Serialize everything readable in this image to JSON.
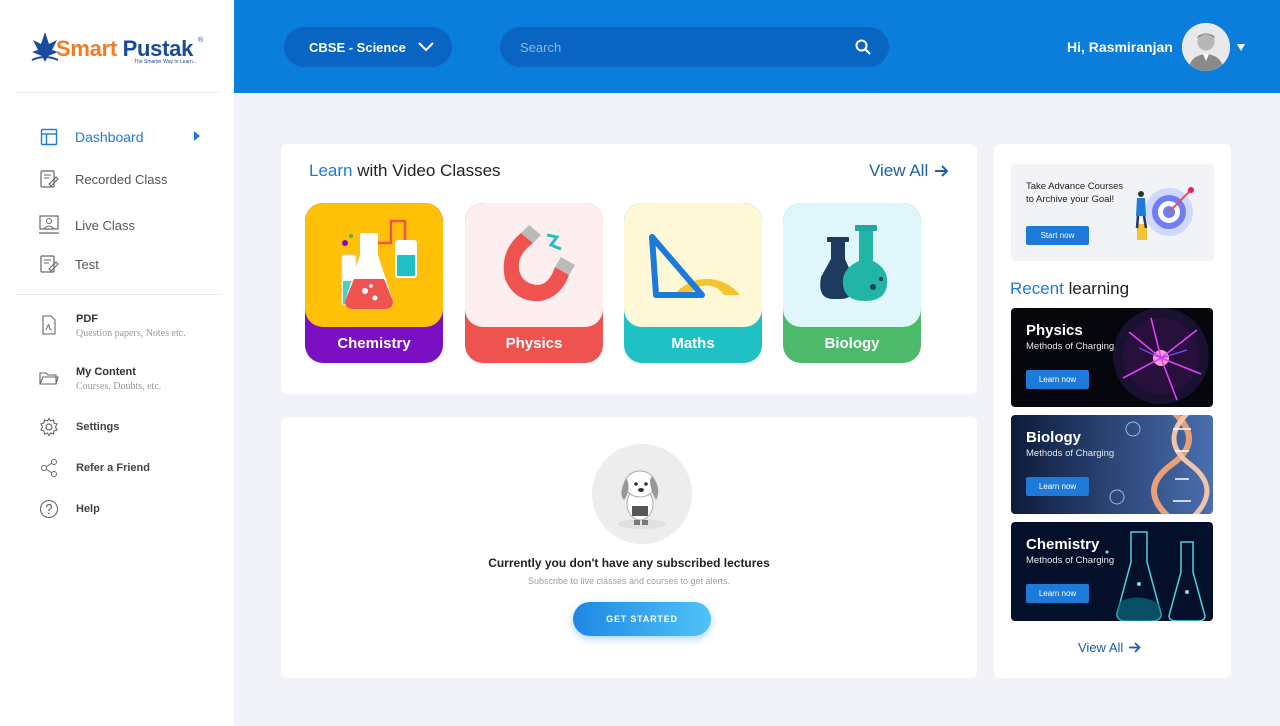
{
  "brand": {
    "name_part1": "Smart",
    "name_part2": " Pustak",
    "tagline": "The Smarter Way to Learn...",
    "reg": "®"
  },
  "sidebar": {
    "items": [
      {
        "label": "Dashboard",
        "icon": "dashboard-icon"
      },
      {
        "label": "Recorded Class",
        "icon": "recorded-class-icon"
      },
      {
        "label": "Live Class",
        "icon": "live-class-icon"
      },
      {
        "label": "Test",
        "icon": "test-icon"
      }
    ],
    "pdf": {
      "title": "PDF",
      "subtitle": "Question papers, Notes etc.",
      "icon": "pdf-icon"
    },
    "my_content": {
      "title": "My Content",
      "subtitle": "Courses, Doubts, etc.",
      "icon": "folder-icon"
    },
    "settings": {
      "label": "Settings",
      "icon": "gear-icon"
    },
    "refer": {
      "label": "Refer a Friend",
      "icon": "share-icon"
    },
    "help": {
      "label": "Help",
      "icon": "help-icon"
    }
  },
  "header": {
    "course": "CBSE - Science",
    "search_placeholder": "Search",
    "greeting": "Hi, Rasmiranjan"
  },
  "learn": {
    "title_highlight": "Learn",
    "title_rest": " with Video Classes",
    "view_all": "View All",
    "subjects": [
      {
        "name": "Chemistry",
        "top_color": "#ffc107",
        "bottom_color": "#7b0fc2"
      },
      {
        "name": "Physics",
        "top_color": "#fdeef0",
        "bottom_color": "#ef5350"
      },
      {
        "name": "Maths",
        "top_color": "#fff8d6",
        "bottom_color": "#20c1c4"
      },
      {
        "name": "Biology",
        "top_color": "#dff6fb",
        "bottom_color": "#4cb96b"
      }
    ]
  },
  "lectures": {
    "empty_title": "Currently you don't have any subscribed lectures",
    "empty_hint": "Subscribe to live classes and courses to get alerts.",
    "cta": "GET STARTED"
  },
  "promo": {
    "text": "Take Advance Courses to Archive your Goal!",
    "button": "Start now"
  },
  "recent": {
    "title_highlight": "Recent",
    "title_rest": " learning",
    "items": [
      {
        "title": "Physics",
        "subtitle": "Methods of Charging",
        "button": "Learn now"
      },
      {
        "title": "Biology",
        "subtitle": "Methods of Charging",
        "button": "Learn now"
      },
      {
        "title": "Chemistry",
        "subtitle": "Methods of Charging",
        "button": "Learn now"
      }
    ],
    "view_all": "View All"
  },
  "colors": {
    "primary": "#0b7ddb",
    "accent": "#1e7ad9",
    "background": "#f1f3f8"
  }
}
